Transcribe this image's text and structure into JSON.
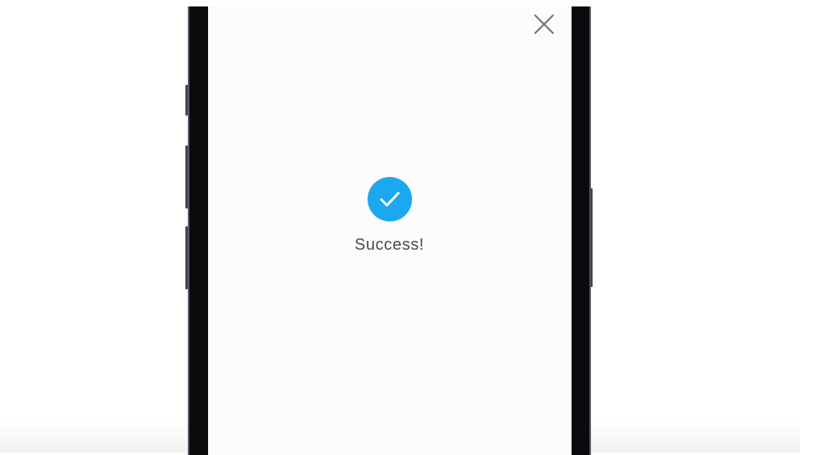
{
  "modal": {
    "close_icon": "close-icon",
    "status_icon": "checkmark-circle-icon",
    "status_text": "Success!",
    "accent_color": "#1ba8ee"
  }
}
